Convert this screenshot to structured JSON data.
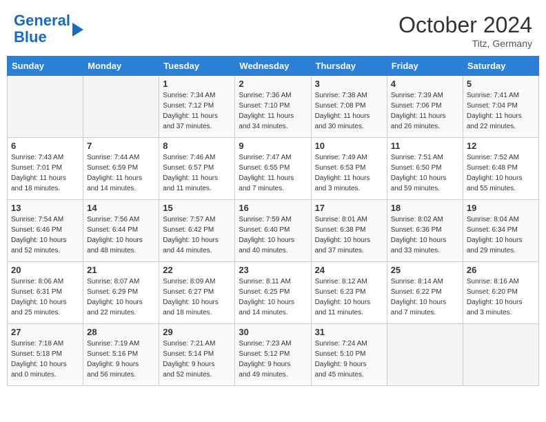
{
  "header": {
    "logo_line1": "General",
    "logo_line2": "Blue",
    "month": "October 2024",
    "location": "Titz, Germany"
  },
  "weekdays": [
    "Sunday",
    "Monday",
    "Tuesday",
    "Wednesday",
    "Thursday",
    "Friday",
    "Saturday"
  ],
  "weeks": [
    [
      {
        "day": "",
        "info": ""
      },
      {
        "day": "",
        "info": ""
      },
      {
        "day": "1",
        "info": "Sunrise: 7:34 AM\nSunset: 7:12 PM\nDaylight: 11 hours\nand 37 minutes."
      },
      {
        "day": "2",
        "info": "Sunrise: 7:36 AM\nSunset: 7:10 PM\nDaylight: 11 hours\nand 34 minutes."
      },
      {
        "day": "3",
        "info": "Sunrise: 7:38 AM\nSunset: 7:08 PM\nDaylight: 11 hours\nand 30 minutes."
      },
      {
        "day": "4",
        "info": "Sunrise: 7:39 AM\nSunset: 7:06 PM\nDaylight: 11 hours\nand 26 minutes."
      },
      {
        "day": "5",
        "info": "Sunrise: 7:41 AM\nSunset: 7:04 PM\nDaylight: 11 hours\nand 22 minutes."
      }
    ],
    [
      {
        "day": "6",
        "info": "Sunrise: 7:43 AM\nSunset: 7:01 PM\nDaylight: 11 hours\nand 18 minutes."
      },
      {
        "day": "7",
        "info": "Sunrise: 7:44 AM\nSunset: 6:59 PM\nDaylight: 11 hours\nand 14 minutes."
      },
      {
        "day": "8",
        "info": "Sunrise: 7:46 AM\nSunset: 6:57 PM\nDaylight: 11 hours\nand 11 minutes."
      },
      {
        "day": "9",
        "info": "Sunrise: 7:47 AM\nSunset: 6:55 PM\nDaylight: 11 hours\nand 7 minutes."
      },
      {
        "day": "10",
        "info": "Sunrise: 7:49 AM\nSunset: 6:53 PM\nDaylight: 11 hours\nand 3 minutes."
      },
      {
        "day": "11",
        "info": "Sunrise: 7:51 AM\nSunset: 6:50 PM\nDaylight: 10 hours\nand 59 minutes."
      },
      {
        "day": "12",
        "info": "Sunrise: 7:52 AM\nSunset: 6:48 PM\nDaylight: 10 hours\nand 55 minutes."
      }
    ],
    [
      {
        "day": "13",
        "info": "Sunrise: 7:54 AM\nSunset: 6:46 PM\nDaylight: 10 hours\nand 52 minutes."
      },
      {
        "day": "14",
        "info": "Sunrise: 7:56 AM\nSunset: 6:44 PM\nDaylight: 10 hours\nand 48 minutes."
      },
      {
        "day": "15",
        "info": "Sunrise: 7:57 AM\nSunset: 6:42 PM\nDaylight: 10 hours\nand 44 minutes."
      },
      {
        "day": "16",
        "info": "Sunrise: 7:59 AM\nSunset: 6:40 PM\nDaylight: 10 hours\nand 40 minutes."
      },
      {
        "day": "17",
        "info": "Sunrise: 8:01 AM\nSunset: 6:38 PM\nDaylight: 10 hours\nand 37 minutes."
      },
      {
        "day": "18",
        "info": "Sunrise: 8:02 AM\nSunset: 6:36 PM\nDaylight: 10 hours\nand 33 minutes."
      },
      {
        "day": "19",
        "info": "Sunrise: 8:04 AM\nSunset: 6:34 PM\nDaylight: 10 hours\nand 29 minutes."
      }
    ],
    [
      {
        "day": "20",
        "info": "Sunrise: 8:06 AM\nSunset: 6:31 PM\nDaylight: 10 hours\nand 25 minutes."
      },
      {
        "day": "21",
        "info": "Sunrise: 8:07 AM\nSunset: 6:29 PM\nDaylight: 10 hours\nand 22 minutes."
      },
      {
        "day": "22",
        "info": "Sunrise: 8:09 AM\nSunset: 6:27 PM\nDaylight: 10 hours\nand 18 minutes."
      },
      {
        "day": "23",
        "info": "Sunrise: 8:11 AM\nSunset: 6:25 PM\nDaylight: 10 hours\nand 14 minutes."
      },
      {
        "day": "24",
        "info": "Sunrise: 8:12 AM\nSunset: 6:23 PM\nDaylight: 10 hours\nand 11 minutes."
      },
      {
        "day": "25",
        "info": "Sunrise: 8:14 AM\nSunset: 6:22 PM\nDaylight: 10 hours\nand 7 minutes."
      },
      {
        "day": "26",
        "info": "Sunrise: 8:16 AM\nSunset: 6:20 PM\nDaylight: 10 hours\nand 3 minutes."
      }
    ],
    [
      {
        "day": "27",
        "info": "Sunrise: 7:18 AM\nSunset: 5:18 PM\nDaylight: 10 hours\nand 0 minutes."
      },
      {
        "day": "28",
        "info": "Sunrise: 7:19 AM\nSunset: 5:16 PM\nDaylight: 9 hours\nand 56 minutes."
      },
      {
        "day": "29",
        "info": "Sunrise: 7:21 AM\nSunset: 5:14 PM\nDaylight: 9 hours\nand 52 minutes."
      },
      {
        "day": "30",
        "info": "Sunrise: 7:23 AM\nSunset: 5:12 PM\nDaylight: 9 hours\nand 49 minutes."
      },
      {
        "day": "31",
        "info": "Sunrise: 7:24 AM\nSunset: 5:10 PM\nDaylight: 9 hours\nand 45 minutes."
      },
      {
        "day": "",
        "info": ""
      },
      {
        "day": "",
        "info": ""
      }
    ]
  ]
}
